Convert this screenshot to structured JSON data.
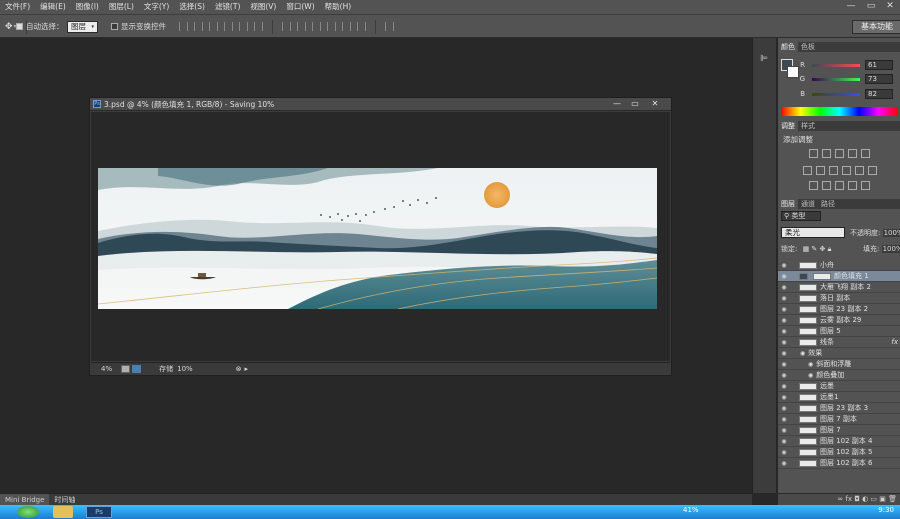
{
  "menubar": {
    "items": [
      "文件(F)",
      "编辑(E)",
      "图像(I)",
      "图层(L)",
      "文字(Y)",
      "选择(S)",
      "滤镜(T)",
      "视图(V)",
      "窗口(W)",
      "帮助(H)"
    ],
    "minimize": "—",
    "restore": "▭",
    "close": "✕"
  },
  "options_bar": {
    "auto_select_label": "自动选择：",
    "auto_select_value": "图层",
    "show_transform_label": "显示变换控件",
    "workspace_label": "基本功能"
  },
  "document": {
    "title": "3.psd @ 4% (颜色填充 1, RGB/8) - Saving 10%",
    "zoom": "4%",
    "status_label": "存储",
    "status_value": "10%",
    "controls": {
      "minimize": "—",
      "restore": "▭",
      "close": "✕"
    }
  },
  "bottom_tabs": [
    "Mini Bridge",
    "时间轴"
  ],
  "color_panel": {
    "tabs": [
      "颜色",
      "色板"
    ],
    "channels": [
      {
        "label": "R",
        "value": "61"
      },
      {
        "label": "G",
        "value": "73"
      },
      {
        "label": "B",
        "value": "82"
      }
    ],
    "foreground": "#3d4952"
  },
  "adjustments_panel": {
    "tabs": [
      "调整",
      "样式"
    ],
    "add_label": "添加调整"
  },
  "layers_panel": {
    "tabs": [
      "图层",
      "通道",
      "路径"
    ],
    "filter_type": "类型",
    "blend_mode": "柔光",
    "opacity_label": "不透明度:",
    "opacity_value": "100%",
    "lock_label": "锁定:",
    "fill_label": "填充:",
    "fill_value": "100%",
    "layers": [
      {
        "name": "小舟",
        "selected": false,
        "indent": 0
      },
      {
        "name": "颜色填充 1",
        "selected": true,
        "indent": 0
      },
      {
        "name": "大雁飞翔 副本 2",
        "selected": false,
        "indent": 0
      },
      {
        "name": "落日 副本",
        "selected": false,
        "indent": 0
      },
      {
        "name": "图层 23 副本 2",
        "selected": false,
        "indent": 0
      },
      {
        "name": "云雾 副本 29",
        "selected": false,
        "indent": 0
      },
      {
        "name": "图层 5",
        "selected": false,
        "indent": 0
      },
      {
        "name": "线条",
        "selected": false,
        "indent": 0,
        "fx": "fx"
      },
      {
        "name": "效果",
        "selected": false,
        "indent": 1
      },
      {
        "name": "斜面和浮雕",
        "selected": false,
        "indent": 2
      },
      {
        "name": "颜色叠加",
        "selected": false,
        "indent": 2
      },
      {
        "name": "远墨",
        "selected": false,
        "indent": 0
      },
      {
        "name": "远墨1",
        "selected": false,
        "indent": 0
      },
      {
        "name": "图层 23 副本 3",
        "selected": false,
        "indent": 0
      },
      {
        "name": "图层 7 副本",
        "selected": false,
        "indent": 0
      },
      {
        "name": "图层 7",
        "selected": false,
        "indent": 0
      },
      {
        "name": "图层 102 副本 4",
        "selected": false,
        "indent": 0
      },
      {
        "name": "图层 102 副本 5",
        "selected": false,
        "indent": 0
      },
      {
        "name": "图层 102 副本 6",
        "selected": false,
        "indent": 0
      }
    ]
  },
  "taskbar": {
    "percent": "41%",
    "clock": "9:30",
    "ps_label": "Ps"
  }
}
